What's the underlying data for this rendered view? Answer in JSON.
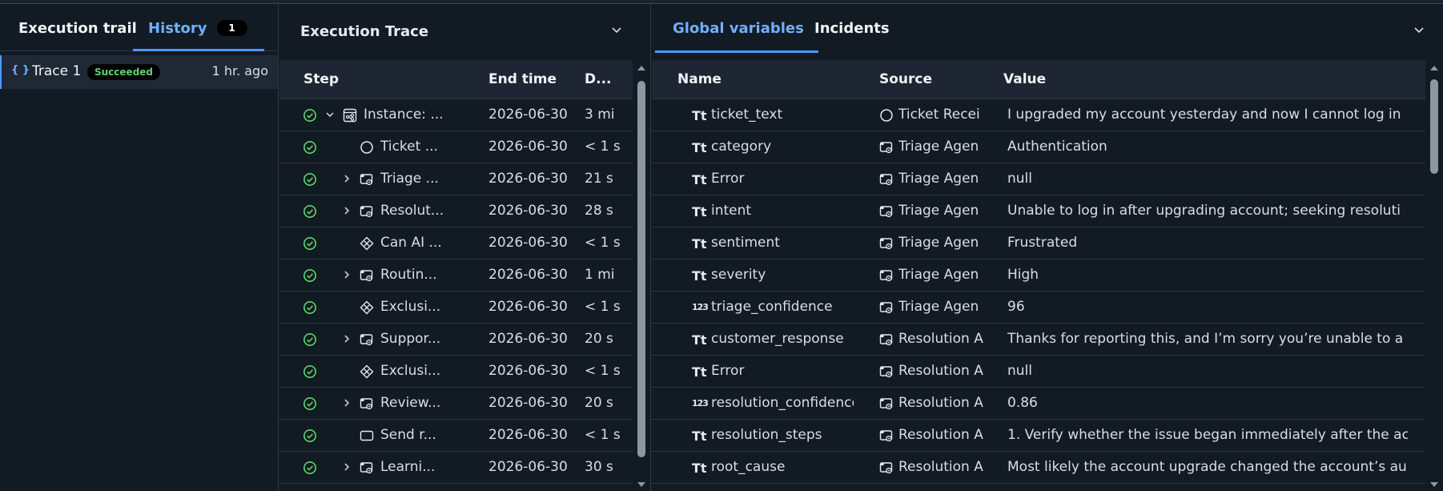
{
  "left": {
    "tabs": [
      {
        "label": "Execution trail",
        "active": false
      },
      {
        "label": "History",
        "active": true,
        "badge": "1"
      }
    ],
    "traces": [
      {
        "name": "Trace 1",
        "status": "Succeeded",
        "ago": "1 hr. ago"
      }
    ]
  },
  "middle": {
    "title": "Execution Trace",
    "columns": {
      "step": "Step",
      "end": "End time",
      "duration": "D..."
    },
    "rows": [
      {
        "indent": 0,
        "expander": "down",
        "icon": "instance",
        "label": "Instance: ...",
        "end": "2026-06-30",
        "dur": "3 mi"
      },
      {
        "indent": 1,
        "expander": "",
        "icon": "circle",
        "label": "Ticket ...",
        "end": "2026-06-30",
        "dur": "< 1 s"
      },
      {
        "indent": 1,
        "expander": "right",
        "icon": "agent",
        "label": "Triage ...",
        "end": "2026-06-30",
        "dur": "21 s"
      },
      {
        "indent": 1,
        "expander": "right",
        "icon": "agent",
        "label": "Resolut...",
        "end": "2026-06-30",
        "dur": "28 s"
      },
      {
        "indent": 1,
        "expander": "",
        "icon": "gateway",
        "label": "Can AI ...",
        "end": "2026-06-30",
        "dur": "< 1 s"
      },
      {
        "indent": 1,
        "expander": "right",
        "icon": "agent",
        "label": "Routin...",
        "end": "2026-06-30",
        "dur": "1 mi"
      },
      {
        "indent": 1,
        "expander": "",
        "icon": "gateway",
        "label": "Exclusi...",
        "end": "2026-06-30",
        "dur": "< 1 s"
      },
      {
        "indent": 1,
        "expander": "right",
        "icon": "agent",
        "label": "Suppor...",
        "end": "2026-06-30",
        "dur": "20 s"
      },
      {
        "indent": 1,
        "expander": "",
        "icon": "gateway",
        "label": "Exclusi...",
        "end": "2026-06-30",
        "dur": "< 1 s"
      },
      {
        "indent": 1,
        "expander": "right",
        "icon": "agent",
        "label": "Review...",
        "end": "2026-06-30",
        "dur": "20 s"
      },
      {
        "indent": 1,
        "expander": "",
        "icon": "task",
        "label": "Send r...",
        "end": "2026-06-30",
        "dur": "< 1 s"
      },
      {
        "indent": 1,
        "expander": "right",
        "icon": "agent",
        "label": "Learni...",
        "end": "2026-06-30",
        "dur": "30 s"
      }
    ]
  },
  "right": {
    "tabs": [
      {
        "label": "Global variables",
        "active": true
      },
      {
        "label": "Incidents",
        "active": false
      }
    ],
    "columns": {
      "name": "Name",
      "source": "Source",
      "value": "Value"
    },
    "rows": [
      {
        "type": "text",
        "name": "ticket_text",
        "source_icon": "circle",
        "source": "Ticket Recei",
        "value": "I upgraded my account yesterday and now I cannot log in"
      },
      {
        "type": "text",
        "name": "category",
        "source_icon": "agent",
        "source": "Triage Agen",
        "value": "Authentication"
      },
      {
        "type": "text",
        "name": "Error",
        "source_icon": "agent",
        "source": "Triage Agen",
        "value": "null"
      },
      {
        "type": "text",
        "name": "intent",
        "source_icon": "agent",
        "source": "Triage Agen",
        "value": "Unable to log in after upgrading account; seeking resoluti"
      },
      {
        "type": "text",
        "name": "sentiment",
        "source_icon": "agent",
        "source": "Triage Agen",
        "value": "Frustrated"
      },
      {
        "type": "text",
        "name": "severity",
        "source_icon": "agent",
        "source": "Triage Agen",
        "value": "High"
      },
      {
        "type": "number",
        "name": "triage_confidence",
        "source_icon": "agent",
        "source": "Triage Agen",
        "value": "96"
      },
      {
        "type": "text",
        "name": "customer_response",
        "source_icon": "agent",
        "source": "Resolution A",
        "value": "Thanks for reporting this, and I’m sorry you’re unable to a"
      },
      {
        "type": "text",
        "name": "Error",
        "source_icon": "agent",
        "source": "Resolution A",
        "value": "null"
      },
      {
        "type": "number",
        "name": "resolution_confidence",
        "source_icon": "agent",
        "source": "Resolution A",
        "value": "0.86"
      },
      {
        "type": "text",
        "name": "resolution_steps",
        "source_icon": "agent",
        "source": "Resolution A",
        "value": "1. Verify whether the issue began immediately after the ac"
      },
      {
        "type": "text",
        "name": "root_cause",
        "source_icon": "agent",
        "source": "Resolution A",
        "value": "Most likely the account upgrade changed the account’s au"
      }
    ],
    "type_glyphs": {
      "text": "Tt",
      "number": "123"
    }
  },
  "colors": {
    "accent": "#4f97ff",
    "success": "#5fd36a",
    "bg": "#121a24",
    "header_bg": "#1d2632"
  }
}
